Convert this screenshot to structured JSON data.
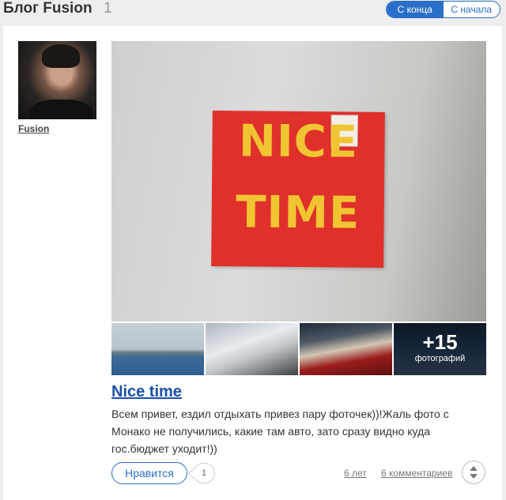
{
  "header": {
    "title": "Блог Fusion",
    "count": "1",
    "sort_newest": "С конца",
    "sort_oldest": "С начала"
  },
  "author": {
    "name": "Fusion"
  },
  "photos": {
    "poster_line1": "NICE",
    "poster_line2": "TIME",
    "more_count": "+15",
    "more_label": "фотографий"
  },
  "post": {
    "title": "Nice time",
    "text": "Всем привет, ездил отдыхать привез пару фоточек))!Жаль фото с Монако не получились, какие там авто, зато сразу видно куда гос.бюджет уходит!))"
  },
  "footer": {
    "like_label": "Нравится",
    "like_count": "1",
    "age": "6 лет",
    "comments": "6 комментариев",
    "sort_icon": "sort-updown-icon"
  },
  "colors": {
    "accent": "#2a6fc9",
    "title_link": "#1a4fa8",
    "poster_red": "#e0302b",
    "poster_yellow": "#f1c532"
  }
}
